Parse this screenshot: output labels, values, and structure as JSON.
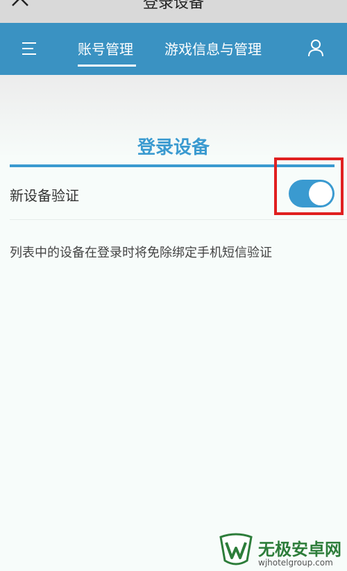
{
  "top_bar": {
    "title": "登录设备",
    "back_icon": "close-chevron-icon"
  },
  "nav": {
    "menu_icon": "menu-icon",
    "tabs": [
      {
        "label": "账号管理",
        "active": true
      },
      {
        "label": "游戏信息与管理",
        "active": false
      }
    ],
    "user_icon": "user-icon"
  },
  "section": {
    "title": "登录设备"
  },
  "setting": {
    "label": "新设备验证",
    "enabled": true
  },
  "description": "列表中的设备在登录时将免除绑定手机短信验证",
  "watermark": {
    "name": "无极安卓网",
    "url": "wjhotelgroup.com"
  },
  "colors": {
    "nav_bg": "#3a92c2",
    "accent": "#3a9ad0",
    "highlight": "#e02020"
  }
}
